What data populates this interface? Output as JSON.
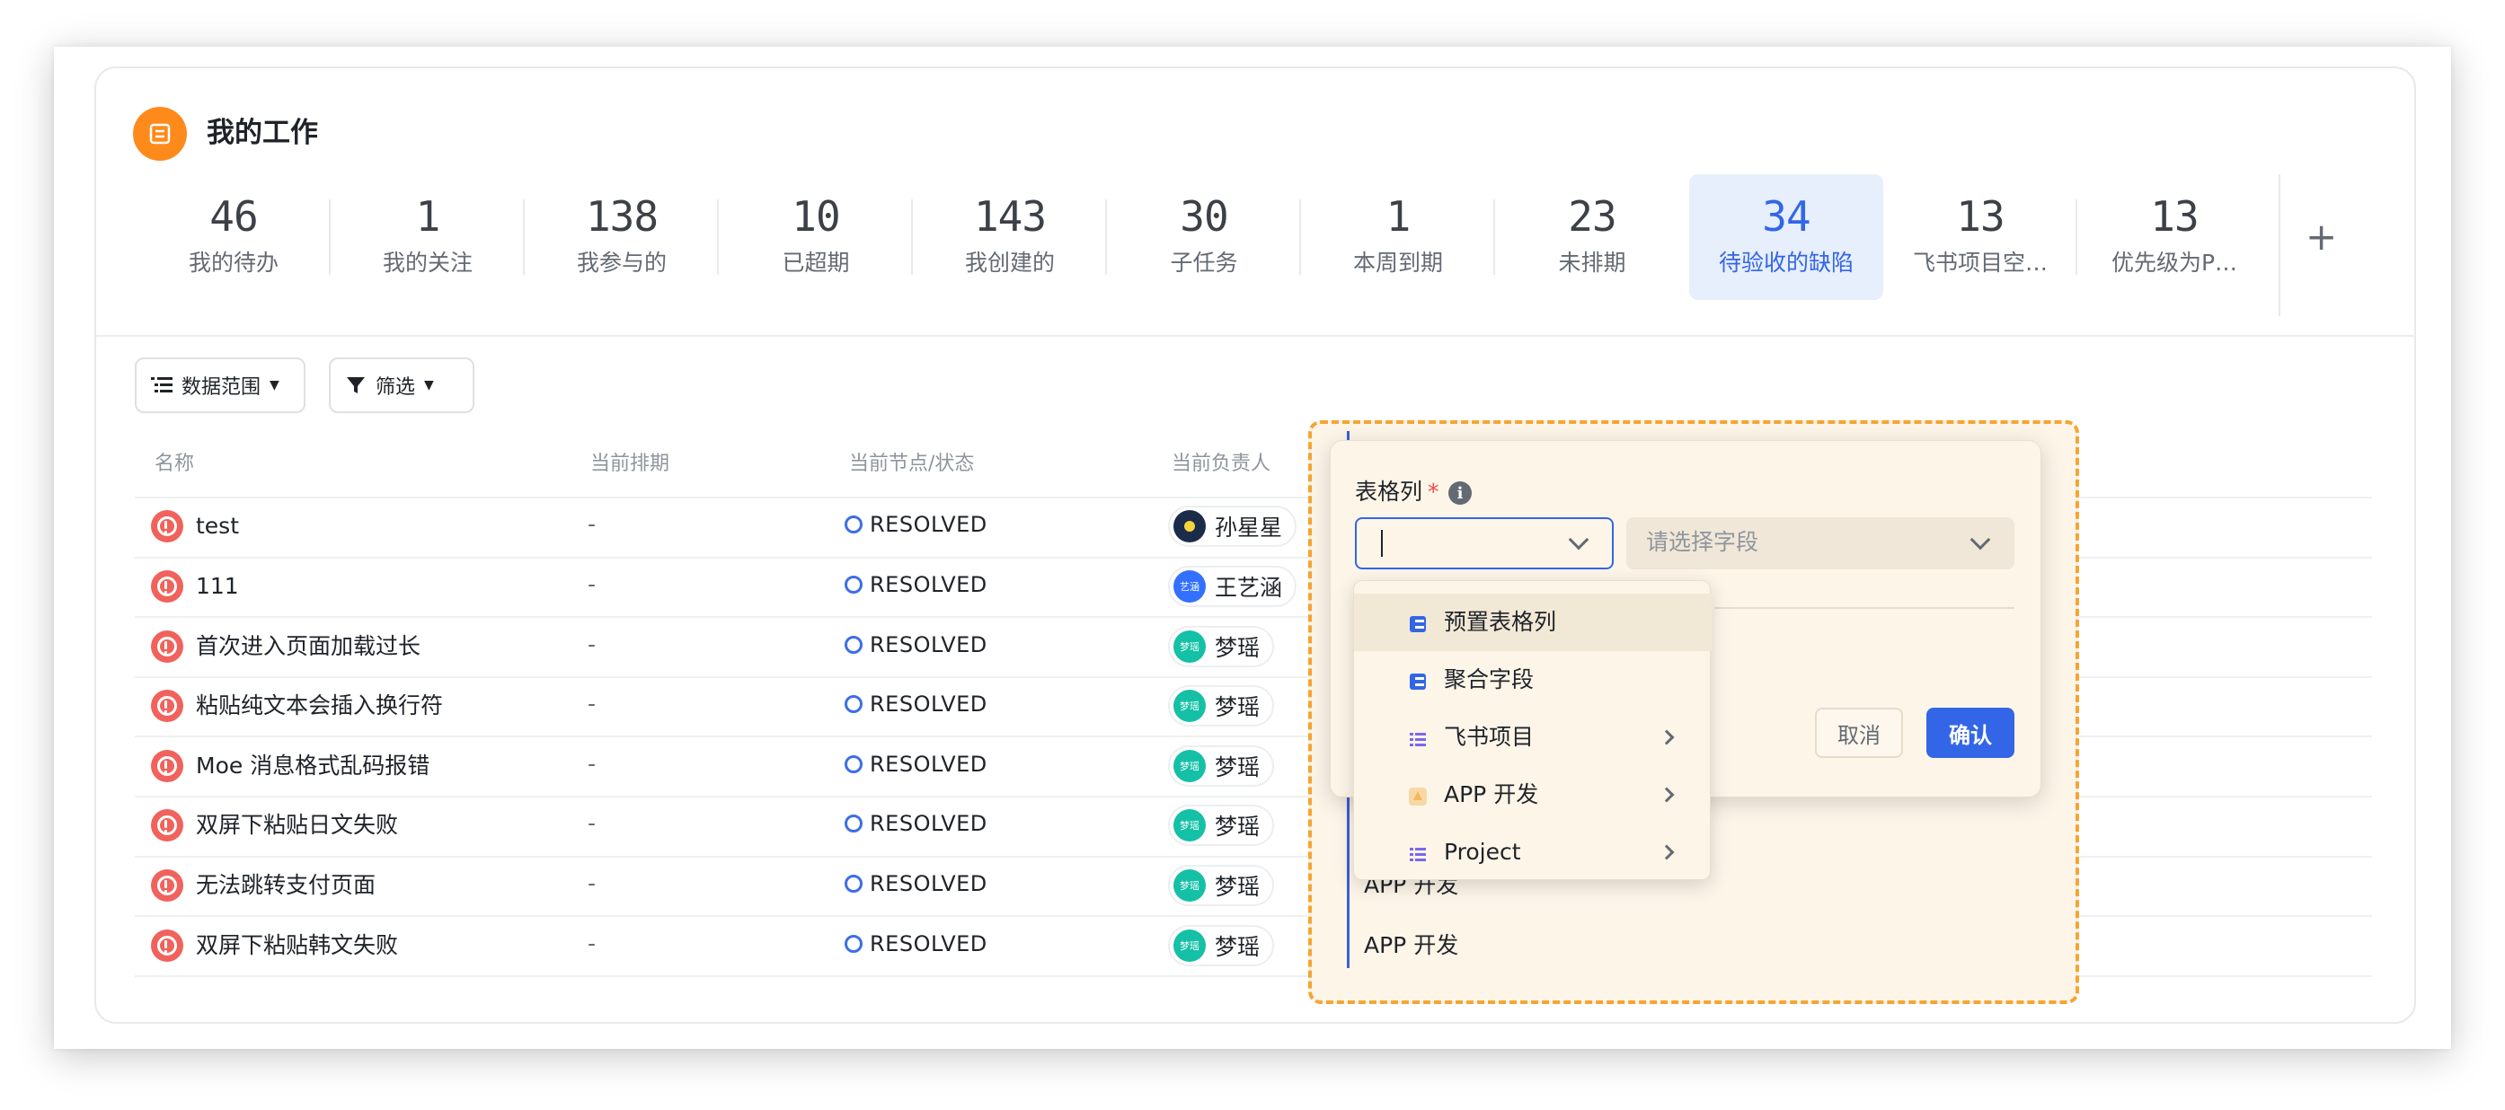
{
  "header": {
    "title": "我的工作",
    "icon": "list-icon",
    "accent": "#ff8a1c"
  },
  "stats": [
    {
      "value": "46",
      "label": "我的待办"
    },
    {
      "value": "1",
      "label": "我的关注"
    },
    {
      "value": "138",
      "label": "我参与的"
    },
    {
      "value": "10",
      "label": "已超期"
    },
    {
      "value": "143",
      "label": "我创建的"
    },
    {
      "value": "30",
      "label": "子任务"
    },
    {
      "value": "1",
      "label": "本周到期"
    },
    {
      "value": "23",
      "label": "未排期"
    },
    {
      "value": "34",
      "label": "待验收的缺陷",
      "active": true
    },
    {
      "value": "13",
      "label": "飞书项目空…"
    },
    {
      "value": "13",
      "label": "优先级为P…"
    }
  ],
  "add_label": "+",
  "toolbar": {
    "scope_label": "数据范围",
    "filter_label": "筛选"
  },
  "table": {
    "columns": [
      "名称",
      "当前排期",
      "当前节点/状态",
      "当前负责人"
    ],
    "rows": [
      {
        "name": "test",
        "schedule": "-",
        "status": "RESOLVED",
        "owner": "孙星星",
        "avatar_color": "#1b2b4a",
        "avatar_text": "",
        "extra": ""
      },
      {
        "name": "111",
        "schedule": "-",
        "status": "RESOLVED",
        "owner": "王艺涵",
        "avatar_color": "#3370ff",
        "avatar_text": "艺涵",
        "extra": ""
      },
      {
        "name": "首次进入页面加载过长",
        "schedule": "-",
        "status": "RESOLVED",
        "owner": "梦瑶",
        "avatar_color": "#14c0a6",
        "avatar_text": "梦瑶",
        "extra": ""
      },
      {
        "name": "粘贴纯文本会插入换行符",
        "schedule": "-",
        "status": "RESOLVED",
        "owner": "梦瑶",
        "avatar_color": "#14c0a6",
        "avatar_text": "梦瑶",
        "extra": ""
      },
      {
        "name": "Moe 消息格式乱码报错",
        "schedule": "-",
        "status": "RESOLVED",
        "owner": "梦瑶",
        "avatar_color": "#14c0a6",
        "avatar_text": "梦瑶",
        "extra": ""
      },
      {
        "name": "双屏下粘贴日文失败",
        "schedule": "-",
        "status": "RESOLVED",
        "owner": "梦瑶",
        "avatar_color": "#14c0a6",
        "avatar_text": "梦瑶",
        "extra": ""
      },
      {
        "name": "无法跳转支付页面",
        "schedule": "-",
        "status": "RESOLVED",
        "owner": "梦瑶",
        "avatar_color": "#14c0a6",
        "avatar_text": "梦瑶",
        "extra": "APP 开发"
      },
      {
        "name": "双屏下粘贴韩文失败",
        "schedule": "-",
        "status": "RESOLVED",
        "owner": "梦瑶",
        "avatar_color": "#14c0a6",
        "avatar_text": "梦瑶",
        "extra": "APP 开发"
      }
    ]
  },
  "popup": {
    "label": "表格列",
    "required_mark": "*",
    "info_icon": "i",
    "field_placeholder": "请选择字段",
    "cancel_label": "取消",
    "confirm_label": "确认"
  },
  "menu": [
    {
      "label": "预置表格列",
      "icon": "table-column-icon",
      "icon_color": "#3366e6",
      "submenu": false
    },
    {
      "label": "聚合字段",
      "icon": "aggregate-field-icon",
      "icon_color": "#3366e6",
      "submenu": false
    },
    {
      "label": "飞书项目",
      "icon": "project-list-icon",
      "icon_color": "#7b67ee",
      "submenu": true
    },
    {
      "label": "APP 开发",
      "icon": "app-dev-icon",
      "icon_color": "#f5b85c",
      "submenu": true
    },
    {
      "label": "Project",
      "icon": "project-list-icon",
      "icon_color": "#7b67ee",
      "submenu": true
    }
  ]
}
